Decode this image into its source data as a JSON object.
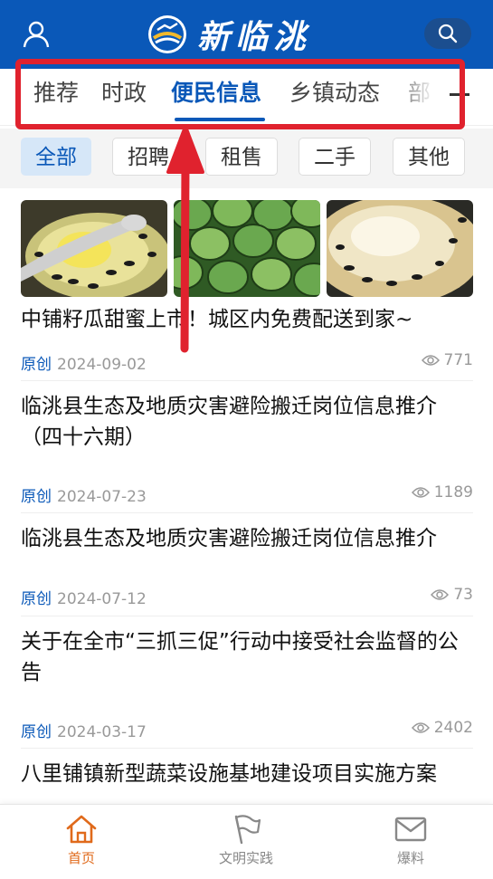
{
  "header": {
    "brand": "新临洮",
    "user_icon": "user-icon",
    "search_icon": "search-icon",
    "color": "#0a58b8"
  },
  "tabs": [
    {
      "label": "推荐",
      "active": false
    },
    {
      "label": "时政",
      "active": false
    },
    {
      "label": "便民信息",
      "active": true
    },
    {
      "label": "乡镇动态",
      "active": false
    },
    {
      "label": "部",
      "active": false
    }
  ],
  "filters": [
    {
      "label": "全部",
      "active": true
    },
    {
      "label": "招聘",
      "active": false
    },
    {
      "label": "租售",
      "active": false
    },
    {
      "label": "二手",
      "active": false
    },
    {
      "label": "其他",
      "active": false
    }
  ],
  "articles": [
    {
      "title": "中铺籽瓜甜蜜上市！城区内免费配送到家~",
      "source": "原创",
      "date": "2024-09-02",
      "views": "771"
    },
    {
      "title": "临洮县生态及地质灾害避险搬迁岗位信息推介（四十六期）",
      "source": "原创",
      "date": "2024-07-23",
      "views": "1189"
    },
    {
      "title": "临洮县生态及地质灾害避险搬迁岗位信息推介",
      "source": "原创",
      "date": "2024-07-12",
      "views": "73"
    },
    {
      "title": "关于在全市“三抓三促”行动中接受社会监督的公告",
      "source": "原创",
      "date": "2024-03-17",
      "views": "2402"
    },
    {
      "title": "八里铺镇新型蔬菜设施基地建设项目实施方案",
      "source": "",
      "date": "",
      "views": ""
    }
  ],
  "bottom_nav": [
    {
      "label": "首页",
      "icon": "home-icon",
      "active": true
    },
    {
      "label": "文明实践",
      "icon": "flag-icon",
      "active": false
    },
    {
      "label": "爆料",
      "icon": "mail-icon",
      "active": false
    }
  ],
  "colors": {
    "accent": "#0a58b8",
    "highlight": "#e0222e",
    "nav_active": "#e06a1b"
  }
}
